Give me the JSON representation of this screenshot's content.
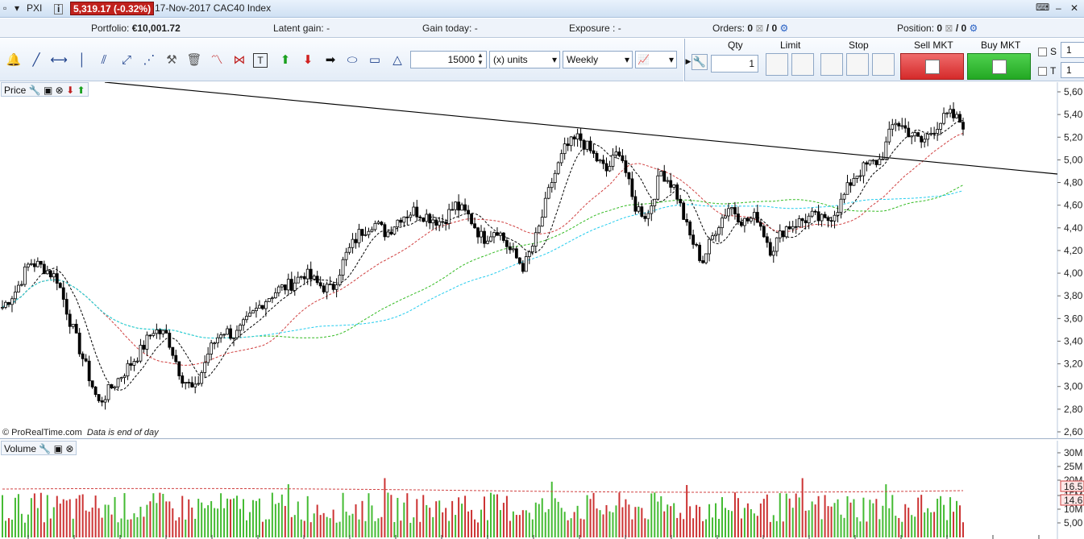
{
  "titlebar": {
    "menu_label": "PXI",
    "info_icon": "i",
    "price_badge": "5,319.17 (-0.32%)",
    "instrument": "17-Nov-2017 CAC40 Index",
    "colors": {
      "badge_bg": "#c0211c"
    }
  },
  "status": {
    "portfolio_label": "Portfolio:",
    "portfolio_value": "€10,001.72",
    "latent_label": "Latent gain:",
    "latent_value": "-",
    "today_label": "Gain today:",
    "today_value": "-",
    "exposure_label": "Exposure :",
    "exposure_value": "-",
    "orders_label": "Orders:",
    "orders_value": "0",
    "orders_value2": "/ 0",
    "position_label": "Position:",
    "position_value": "0",
    "position_value2": "/ 0"
  },
  "toolbar": {
    "quantity_value": "15000",
    "units_value": "(x) units",
    "timeframe_value": "Weekly"
  },
  "orders": {
    "qty_label": "Qty",
    "qty_value": "1",
    "limit_label": "Limit",
    "stop_label": "Stop",
    "sell_label": "Sell MKT",
    "buy_label": "Buy MKT",
    "side_s": "S",
    "side_t": "T",
    "side_s_value": "1",
    "side_t_value": "1"
  },
  "price_panel": {
    "label": "Price",
    "copyright": "© ProRealTime.com",
    "note": "Data is end of day",
    "y_ticks": [
      "5,60",
      "5,40",
      "5,20",
      "5,00",
      "4,80",
      "4,60",
      "4,40",
      "4,20",
      "4,00",
      "3,80",
      "3,60",
      "3,40",
      "3,20",
      "3,00",
      "2,80",
      "2,60"
    ]
  },
  "volume_panel": {
    "label": "Volume",
    "y_ticks": [
      "30M",
      "25M",
      "20M",
      "15M",
      "10M",
      "5,00"
    ],
    "ma_label_1": "16.5",
    "ma_label_2": "14.6"
  },
  "colors": {
    "candle": "#000000",
    "ma_black": "#000000",
    "ma_red": "#d04040",
    "ma_green": "#33bb22",
    "ma_cyan": "#22ccee",
    "vol_up": "#44bb33",
    "vol_down": "#cc3333"
  },
  "chart_data": {
    "type": "candlestick",
    "timeframe": "Weekly",
    "instrument": "CAC40 Index",
    "ylim": [
      2.6,
      5.6
    ],
    "close_path": [
      3.7,
      3.85,
      4.1,
      4.05,
      3.95,
      3.55,
      3.2,
      2.85,
      3.0,
      3.15,
      3.3,
      3.5,
      3.45,
      3.1,
      2.95,
      3.3,
      3.5,
      3.45,
      3.6,
      3.75,
      3.85,
      3.9,
      4.0,
      3.9,
      3.85,
      4.15,
      4.35,
      4.45,
      4.35,
      4.5,
      4.55,
      4.5,
      4.45,
      4.6,
      4.5,
      4.3,
      4.4,
      4.2,
      4.05,
      4.35,
      4.8,
      5.1,
      5.2,
      5.05,
      4.9,
      5.1,
      4.6,
      4.5,
      4.9,
      4.75,
      4.35,
      4.1,
      4.4,
      4.6,
      4.45,
      4.5,
      4.2,
      4.4,
      4.45,
      4.5,
      4.45,
      4.6,
      4.85,
      4.95,
      5.0,
      5.35,
      5.25,
      5.15,
      5.3,
      5.4,
      5.32
    ],
    "trendline": {
      "start": 5.9,
      "end": 4.88
    },
    "volume": "weekly bars with 16.5M and 14.6M moving averages"
  }
}
